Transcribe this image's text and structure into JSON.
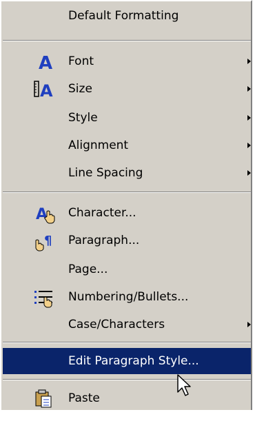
{
  "menu": {
    "items": [
      {
        "id": "default-formatting",
        "label": "Default Formatting",
        "submenu": false
      },
      {
        "id": "font",
        "label": "Font",
        "submenu": true,
        "icon": "font-icon"
      },
      {
        "id": "size",
        "label": "Size",
        "submenu": true,
        "icon": "size-icon"
      },
      {
        "id": "style",
        "label": "Style",
        "submenu": true
      },
      {
        "id": "alignment",
        "label": "Alignment",
        "submenu": true
      },
      {
        "id": "line-spacing",
        "label": "Line Spacing",
        "submenu": true
      },
      {
        "id": "character",
        "label": "Character...",
        "submenu": false,
        "icon": "character-icon"
      },
      {
        "id": "paragraph",
        "label": "Paragraph...",
        "submenu": false,
        "icon": "paragraph-icon"
      },
      {
        "id": "page",
        "label": "Page...",
        "submenu": false
      },
      {
        "id": "numbering-bullets",
        "label": "Numbering/Bullets...",
        "submenu": false,
        "icon": "numbering-bullets-icon"
      },
      {
        "id": "case-characters",
        "label": "Case/Characters",
        "submenu": true
      },
      {
        "id": "edit-paragraph-style",
        "label": "Edit Paragraph Style...",
        "submenu": false,
        "highlighted": true
      },
      {
        "id": "paste",
        "label": "Paste",
        "submenu": false,
        "icon": "paste-icon"
      }
    ]
  },
  "colors": {
    "menu_bg": "#d4d0c8",
    "highlight_bg": "#0a246a",
    "highlight_text": "#ffffff",
    "icon_blue": "#1f3fbf"
  }
}
